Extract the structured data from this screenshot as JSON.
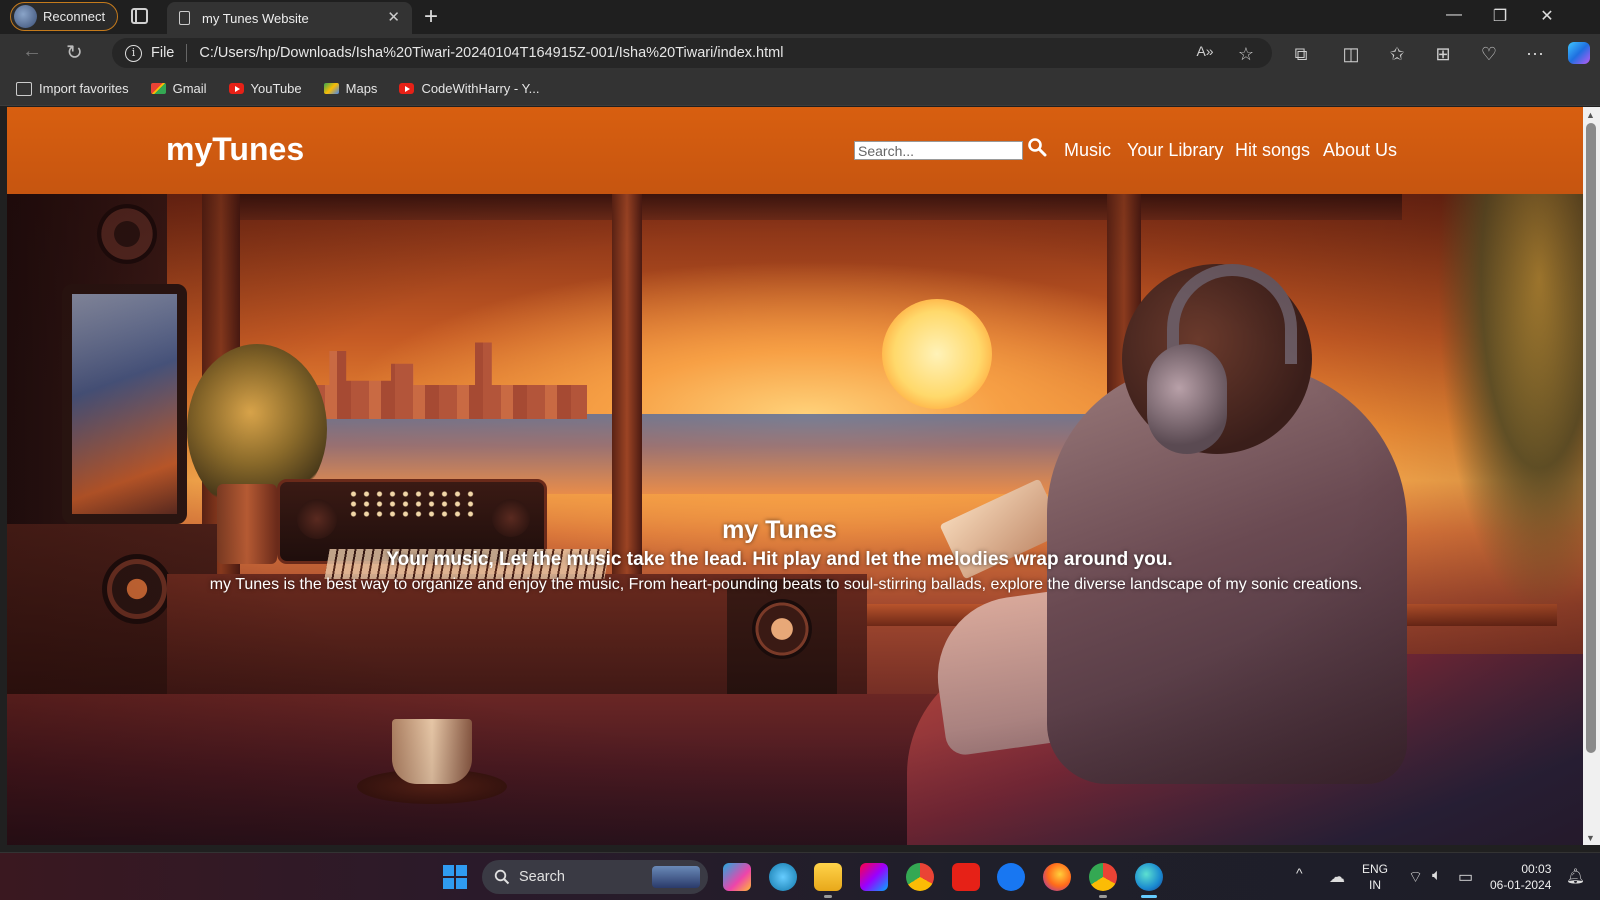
{
  "browser": {
    "reconnect_label": "Reconnect",
    "tab_title": "my Tunes Website",
    "file_label": "File",
    "url": "C:/Users/hp/Downloads/Isha%20Tiwari-20240104T164915Z-001/Isha%20Tiwari/index.html",
    "bookmarks": [
      {
        "label": "Import favorites",
        "icon": "import-icon"
      },
      {
        "label": "Gmail",
        "icon": "gmail-icon"
      },
      {
        "label": "YouTube",
        "icon": "youtube-icon"
      },
      {
        "label": "Maps",
        "icon": "maps-icon"
      },
      {
        "label": "CodeWithHarry - Y...",
        "icon": "youtube-icon"
      }
    ]
  },
  "site": {
    "brand": "myTunes",
    "search_placeholder": "Search...",
    "nav": [
      "Music",
      "Your Library",
      "Hit songs",
      "About Us"
    ],
    "header_color": "#d25a10"
  },
  "hero": {
    "title": "my Tunes",
    "tagline": "Your music, Let the music take the lead. Hit play and let the melodies wrap around you.",
    "description": "my Tunes is the best way to organize and enjoy the music, From heart-pounding beats to soul-stirring ballads, explore the diverse landscape of my sonic creations."
  },
  "taskbar": {
    "search_label": "Search",
    "apps": [
      "copilot-icon",
      "help-icon",
      "file-explorer-icon",
      "jetbrains-icon",
      "chrome-icon",
      "youtube-icon",
      "facebook-icon",
      "firefox-icon",
      "chrome-profile-icon",
      "edge-icon"
    ],
    "language": "ENG",
    "region": "IN",
    "time": "00:03",
    "date": "06-01-2024"
  }
}
